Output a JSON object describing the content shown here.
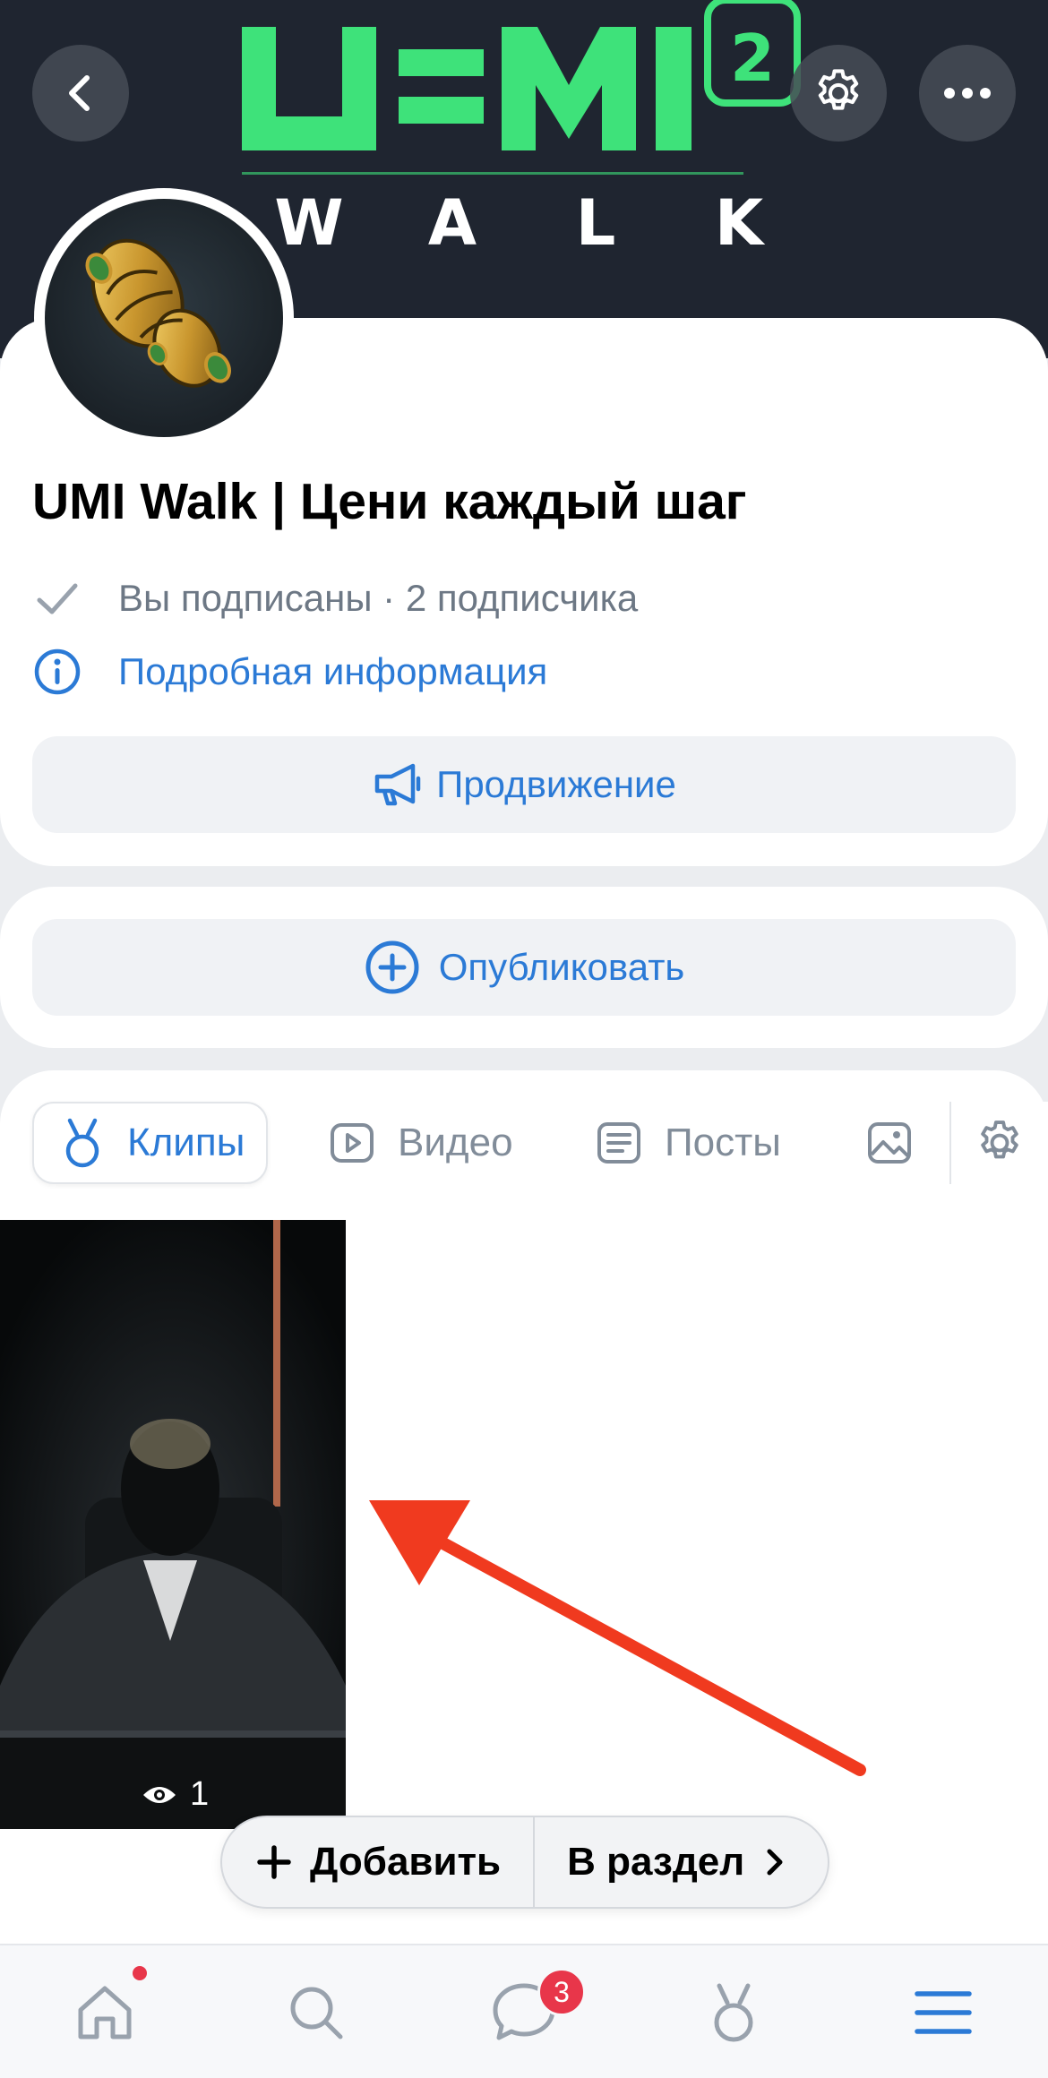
{
  "cover": {
    "logo_walk_letters": [
      "W",
      "A",
      "L",
      "K"
    ],
    "logo_wordmark": "UMI² WALK",
    "buttons": [
      {
        "name": "back-button",
        "icon": "chevron-left-icon"
      },
      {
        "name": "settings-button",
        "icon": "gear-icon"
      },
      {
        "name": "more-button",
        "icon": "more-horizontal-icon"
      }
    ]
  },
  "profile": {
    "title": "UMI Walk | Цени каждый шаг",
    "subscribed_text": "Вы подписаны",
    "separator": " · ",
    "subscribers_count": "2",
    "subscribers_label": " подписчика",
    "info_link": "Подробная информация",
    "promote_button": "Продвижение"
  },
  "publish": {
    "button_label": "Опубликовать"
  },
  "tabs": [
    {
      "label": "Клипы",
      "icon": "clips-icon",
      "active": true
    },
    {
      "label": "Видео",
      "icon": "video-icon",
      "active": false
    },
    {
      "label": "Посты",
      "icon": "posts-icon",
      "active": false
    },
    {
      "label": "",
      "icon": "photo-icon",
      "active": false
    }
  ],
  "clips": [
    {
      "views": "1"
    }
  ],
  "actions": {
    "add_label": "Добавить",
    "to_section_label": "В раздел"
  },
  "tabbar": {
    "items": [
      {
        "icon": "home-icon",
        "has_dot": true
      },
      {
        "icon": "search-icon"
      },
      {
        "icon": "messages-icon",
        "badge": "3"
      },
      {
        "icon": "clips-icon"
      },
      {
        "icon": "menu-icon"
      }
    ]
  },
  "colors": {
    "accent": "#2b7ad6",
    "logo_green": "#3ee27a",
    "cover_bg": "#1f2530",
    "badge_red": "#e8364a",
    "arrow_red": "#f03a1f"
  }
}
